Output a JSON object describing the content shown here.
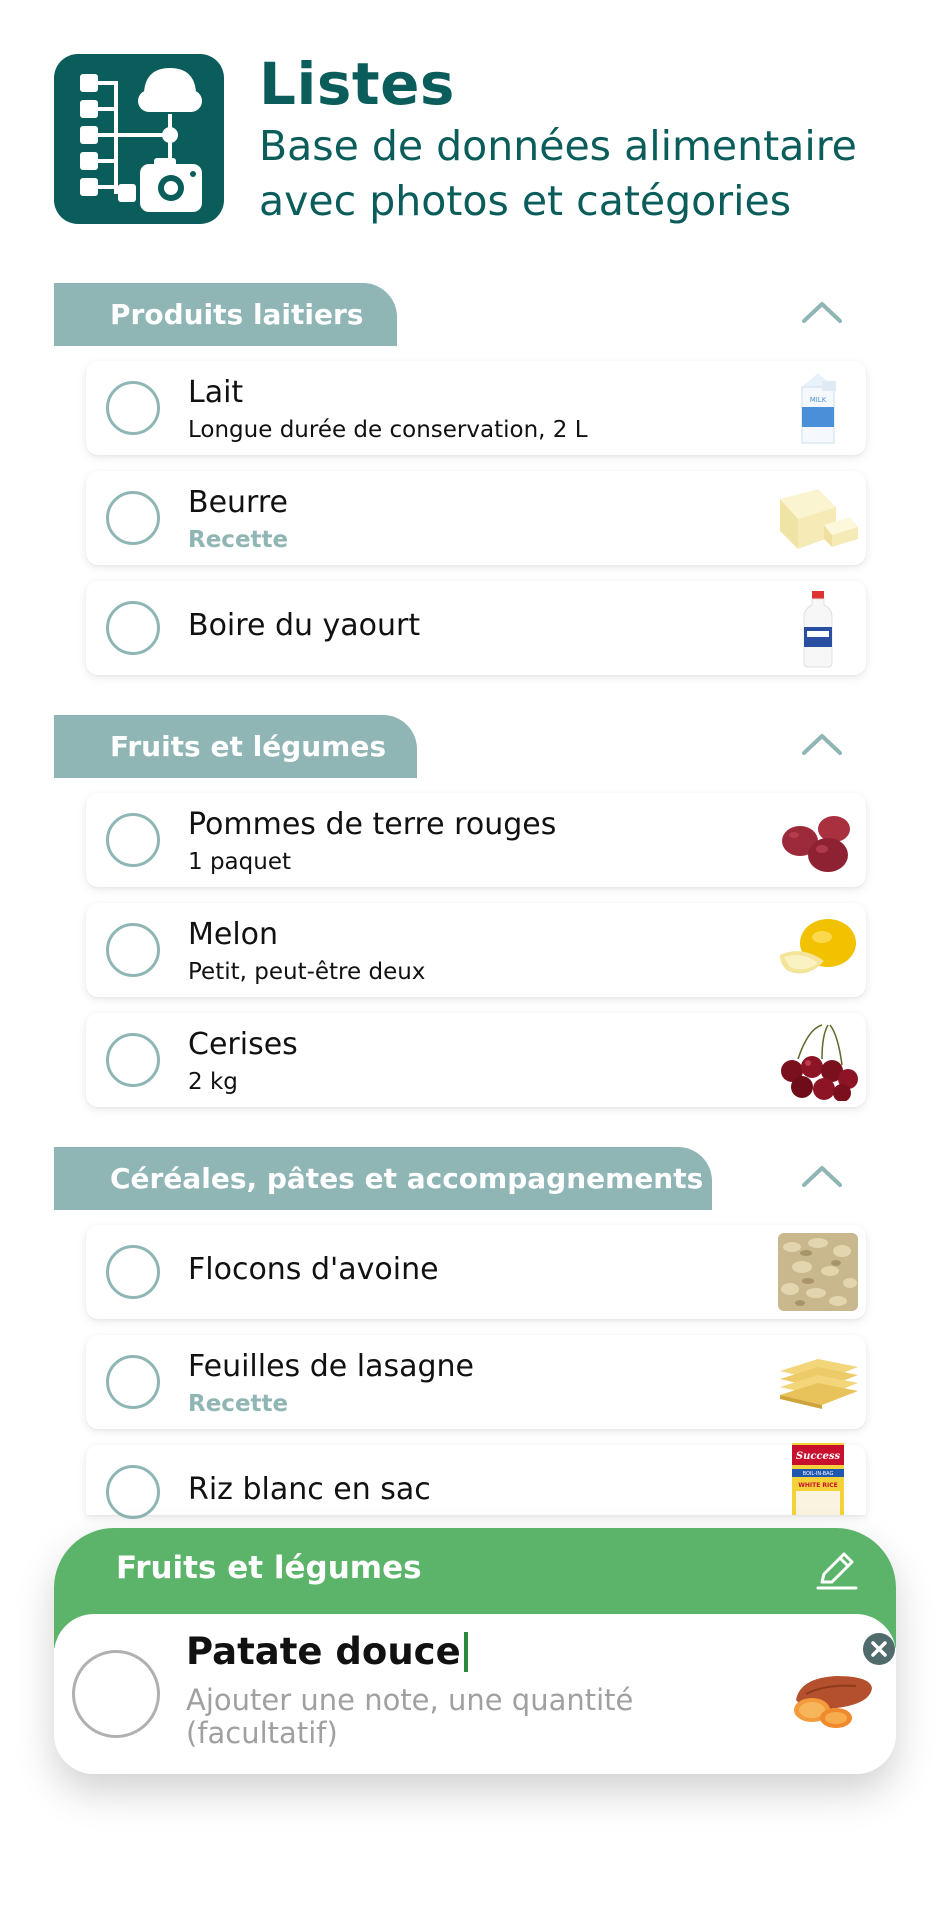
{
  "header": {
    "title": "Listes",
    "subtitle": "Base de données alimentaire avec photos et catégories",
    "icon": "list-tree-camera-icon"
  },
  "sections": [
    {
      "label": "Produits laitiers",
      "items": [
        {
          "name": "Lait",
          "note": "Longue durée de conservation, 2 L",
          "image": "milk-carton"
        },
        {
          "name": "Beurre",
          "note": "Recette",
          "image": "butter"
        },
        {
          "name": "Boire du yaourt",
          "note": "",
          "image": "yogurt-drink-bottle"
        }
      ]
    },
    {
      "label": "Fruits et légumes",
      "items": [
        {
          "name": "Pommes de terre rouges",
          "note": "1 paquet",
          "image": "red-potatoes"
        },
        {
          "name": "Melon",
          "note": "Petit, peut-être deux",
          "image": "melon"
        },
        {
          "name": "Cerises",
          "note": "2 kg",
          "image": "cherries"
        }
      ]
    },
    {
      "label": "Céréales, pâtes et accompagnements",
      "items": [
        {
          "name": "Flocons d'avoine",
          "note": "",
          "image": "oats"
        },
        {
          "name": "Feuilles de lasagne",
          "note": "Recette",
          "image": "lasagna-sheets"
        },
        {
          "name": "Riz blanc en sac",
          "note": "",
          "image": "rice-box"
        }
      ]
    }
  ],
  "rice_box_text": {
    "brand": "Success",
    "tag": "BOIL-IN-BAG",
    "label": "WHITE RICE"
  },
  "milk_label": "MILK",
  "editor": {
    "category": "Fruits et légumes",
    "item_name": "Patate douce",
    "note_placeholder": "Ajouter une note, une quantité (facultatif)",
    "image": "sweet-potato"
  },
  "colors": {
    "brand": "#0b5d5b",
    "section_tab": "#8fb5b5",
    "editor_bar": "#5cb46b"
  }
}
